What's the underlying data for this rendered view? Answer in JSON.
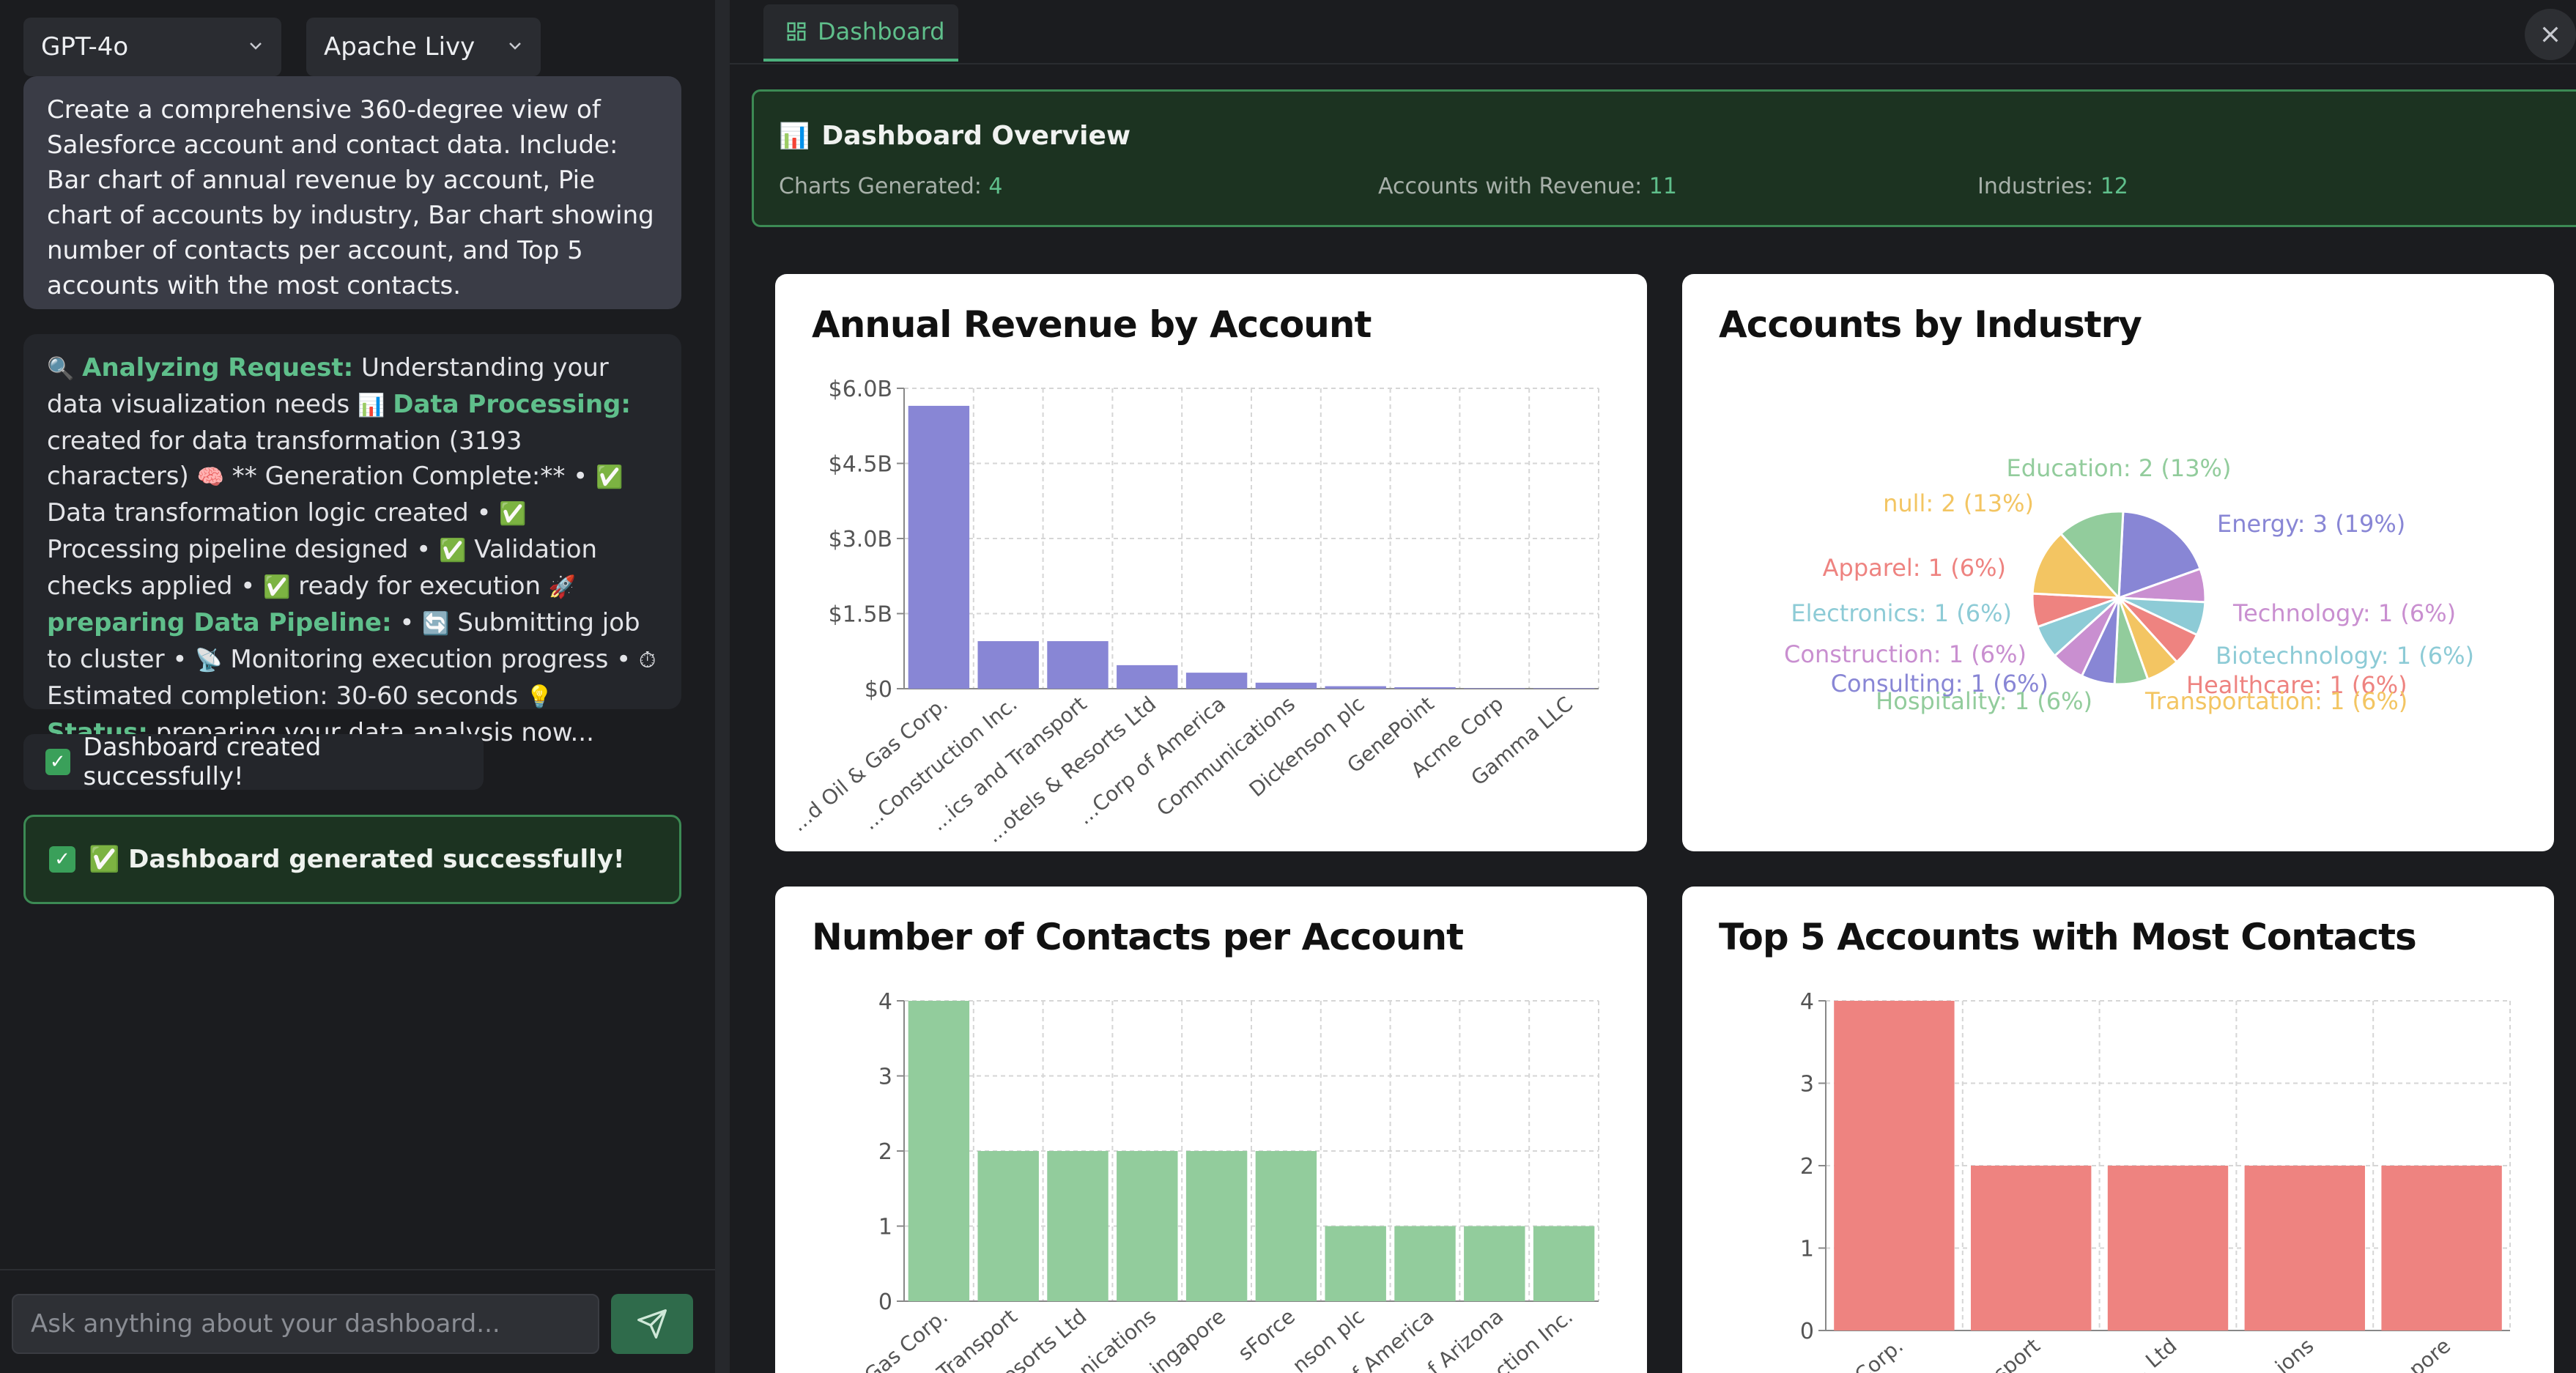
{
  "selectors": {
    "model": "GPT-4o",
    "engine": "Apache Livy"
  },
  "prompt": "Create a comprehensive 360-degree view of Salesforce account and contact data. Include: Bar chart of annual revenue by account, Pie chart of accounts by industry, Bar chart showing number of contacts per account, and Top 5 accounts with the most contacts.",
  "status_message": {
    "analyzing_label": "Analyzing Request:",
    "analyzing_text": " Understanding your data visualization needs ",
    "processing_label": "Data Processing:",
    "processing_text": " created for data transformation (3193 characters) ",
    "generation_text": " ** Generation Complete:** • ",
    "transform_text": " Data transformation logic created • ",
    "pipeline_text": " Processing pipeline designed • ",
    "validation_text": " Validation checks applied • ",
    "ready_text": " ready for execution ",
    "preparing_label": "preparing Data Pipeline:",
    "submit_text": " • ",
    "submitting_text": " Submitting job to cluster • ",
    "monitoring_text": " Monitoring execution progress • ",
    "estimated_text": " Estimated completion: 30-60 seconds ",
    "status_label": "Status:",
    "status_text": " preparing your data analysis now..."
  },
  "created_message": "Dashboard created successfully!",
  "generated_message": "✅ Dashboard generated successfully!",
  "chat_input_placeholder": "Ask anything about your dashboard...",
  "tab_label": "Dashboard",
  "overview": {
    "title": "Dashboard Overview",
    "charts_label": "Charts Generated: ",
    "charts_value": "4",
    "accounts_label": "Accounts with Revenue: ",
    "accounts_value": "11",
    "industries_label": "Industries: ",
    "industries_value": "12"
  },
  "colors": {
    "accent_green": "#5fbf8b",
    "revenue_bar": "#8886d5",
    "contacts_bar": "#92cc9c",
    "top5_bar": "#ee8380"
  },
  "chart_data": [
    {
      "type": "bar",
      "title": "Annual Revenue by Account",
      "categories": [
        "...d Oil & Gas Corp.",
        "...Construction Inc.",
        "...ics and Transport",
        "...otels & Resorts Ltd",
        "...Corp of America",
        "Communications",
        "Dickenson plc",
        "GenePoint",
        "Acme Corp",
        "Gamma LLC"
      ],
      "values": [
        5.65,
        0.95,
        0.95,
        0.47,
        0.32,
        0.12,
        0.05,
        0.03,
        0.01,
        0.01
      ],
      "ylim": [
        0,
        6.0
      ],
      "yticks": [
        0,
        1.5,
        3.0,
        4.5,
        6.0
      ],
      "ytick_labels": [
        "$0",
        "$1.5B",
        "$3.0B",
        "$4.5B",
        "$6.0B"
      ],
      "grid": true
    },
    {
      "type": "pie",
      "title": "Accounts by Industry",
      "slices": [
        {
          "label": "Energy: 3 (19%)",
          "value": 3,
          "color": "#8886d5"
        },
        {
          "label": "Technology: 1 (6%)",
          "value": 1,
          "color": "#c98fd0"
        },
        {
          "label": "Biotechnology: 1 (6%)",
          "value": 1,
          "color": "#8dcbd6"
        },
        {
          "label": "Healthcare: 1 (6%)",
          "value": 1,
          "color": "#ee8380"
        },
        {
          "label": "Transportation: 1 (6%)",
          "value": 1,
          "color": "#f3c562"
        },
        {
          "label": "Hospitality: 1 (6%)",
          "value": 1,
          "color": "#92cc9c"
        },
        {
          "label": "Consulting: 1 (6%)",
          "value": 1,
          "color": "#8886d5"
        },
        {
          "label": "Construction: 1 (6%)",
          "value": 1,
          "color": "#c98fd0"
        },
        {
          "label": "Electronics: 1 (6%)",
          "value": 1,
          "color": "#8dcbd6"
        },
        {
          "label": "Apparel: 1 (6%)",
          "value": 1,
          "color": "#ee8380"
        },
        {
          "label": "null: 2 (13%)",
          "value": 2,
          "color": "#f3c562"
        },
        {
          "label": "Education: 2 (13%)",
          "value": 2,
          "color": "#92cc9c"
        }
      ]
    },
    {
      "type": "bar",
      "title": "Number of Contacts per Account",
      "categories": [
        "...Gas Corp.",
        "...Transport",
        "...esorts Ltd",
        "...nications",
        "...ingapore",
        "sForce",
        "...nson plc",
        "...f America",
        "...f Arizona",
        "...ction Inc."
      ],
      "values": [
        4,
        2,
        2,
        2,
        2,
        2,
        1,
        1,
        1,
        1
      ],
      "ylim": [
        0,
        4
      ],
      "yticks": [
        0,
        1,
        2,
        3,
        4
      ],
      "grid": true
    },
    {
      "type": "bar",
      "title": "Top 5 Accounts with Most Contacts",
      "categories": [
        "...Corp.",
        "...sport",
        "... Ltd",
        "...ions",
        "...pore"
      ],
      "values": [
        4,
        2,
        2,
        2,
        2
      ],
      "ylim": [
        0,
        4
      ],
      "yticks": [
        0,
        1,
        2,
        3,
        4
      ],
      "grid": true
    }
  ]
}
